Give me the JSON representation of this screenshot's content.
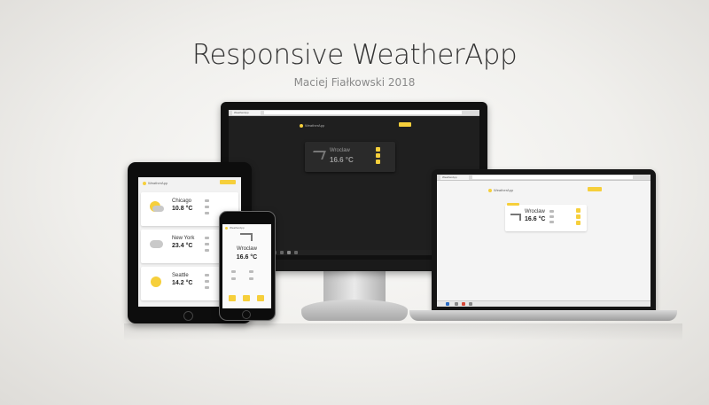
{
  "header": {
    "title": "Responsive WeatherApp",
    "subtitle": "Maciej Fiałkowski 2018"
  },
  "app": {
    "name": "WeatherApp",
    "browser_tab": "WeatherApp",
    "accent_color": "#f6cf3b"
  },
  "monitor": {
    "city": "Wroclaw",
    "temp": "16.6 °C",
    "theme": "dark"
  },
  "laptop": {
    "city": "Wroclaw",
    "temp": "16.6 °C",
    "theme": "light"
  },
  "tablet": {
    "cards": [
      {
        "city": "Chicago",
        "temp": "10.8 °C",
        "icon": "partly-cloudy-icon"
      },
      {
        "city": "New York",
        "temp": "23.4 °C",
        "icon": "cloud-icon"
      },
      {
        "city": "Seattle",
        "temp": "14.2 °C",
        "icon": "sun-icon"
      }
    ]
  },
  "phone": {
    "city": "Wroclaw",
    "temp": "16.6 °C",
    "icon": "wind-icon"
  }
}
